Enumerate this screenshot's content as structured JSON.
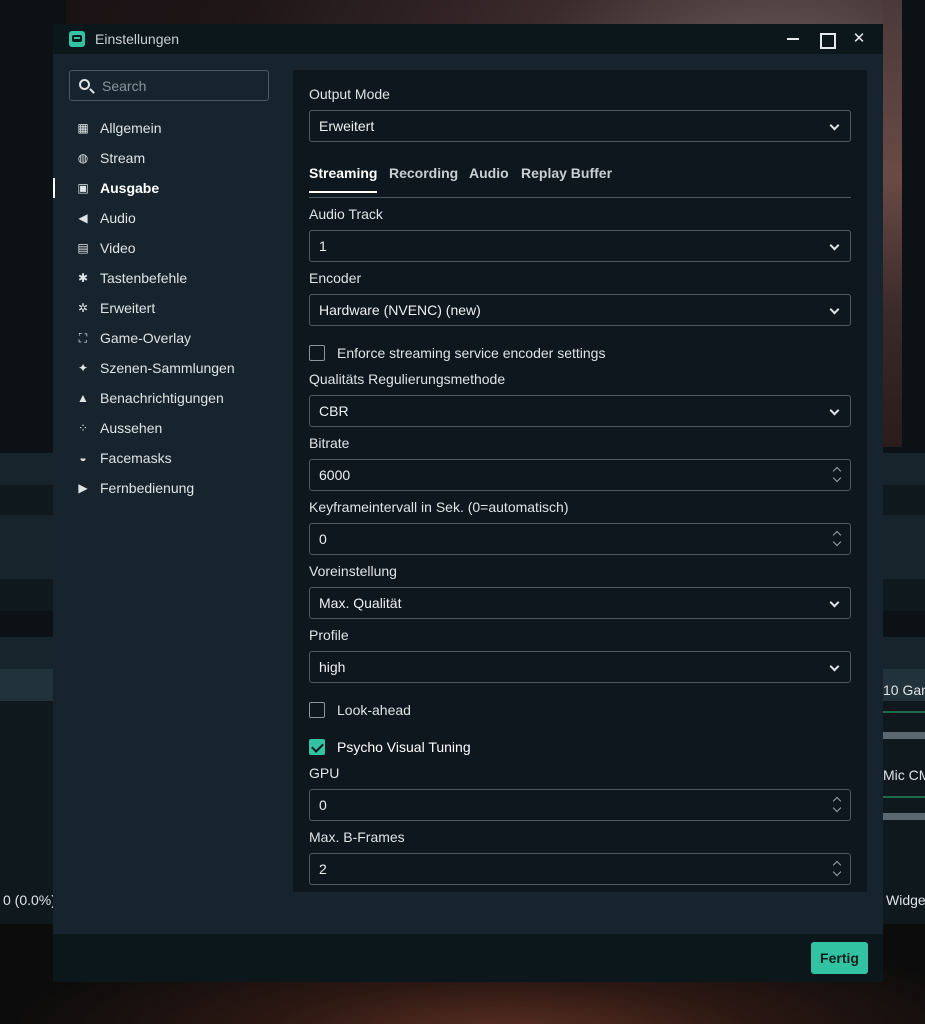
{
  "background": {
    "left_status": "0 (0.0%)",
    "right_labels": [
      "10 Gan",
      "Mic CM",
      "Widge"
    ]
  },
  "window": {
    "title": "Einstellungen"
  },
  "sidebar": {
    "search_placeholder": "Search",
    "items": [
      {
        "label": "Allgemein",
        "icon": "grid-icon"
      },
      {
        "label": "Stream",
        "icon": "globe-icon"
      },
      {
        "label": "Ausgabe",
        "icon": "chip-icon",
        "active": true
      },
      {
        "label": "Audio",
        "icon": "speaker-icon"
      },
      {
        "label": "Video",
        "icon": "film-icon"
      },
      {
        "label": "Tastenbefehle",
        "icon": "gear-icon"
      },
      {
        "label": "Erweitert",
        "icon": "gears-icon"
      },
      {
        "label": "Game-Overlay",
        "icon": "expand-icon"
      },
      {
        "label": "Szenen-Sammlungen",
        "icon": "wand-icon"
      },
      {
        "label": "Benachrichtigungen",
        "icon": "bell-icon"
      },
      {
        "label": "Aussehen",
        "icon": "apps-icon"
      },
      {
        "label": "Facemasks",
        "icon": "mask-icon"
      },
      {
        "label": "Fernbedienung",
        "icon": "play-circle-icon"
      }
    ]
  },
  "output": {
    "mode_label": "Output Mode",
    "mode_value": "Erweitert",
    "tabs": [
      {
        "label": "Streaming",
        "active": true
      },
      {
        "label": "Recording"
      },
      {
        "label": "Audio"
      },
      {
        "label": "Replay Buffer"
      }
    ],
    "audio_track": {
      "label": "Audio Track",
      "value": "1"
    },
    "encoder": {
      "label": "Encoder",
      "value": "Hardware (NVENC) (new)"
    },
    "enforce": {
      "label": "Enforce streaming service encoder settings",
      "checked": false
    },
    "rate_control": {
      "label": "Qualitäts Regulierungsmethode",
      "value": "CBR"
    },
    "bitrate": {
      "label": "Bitrate",
      "value": "6000"
    },
    "keyframe": {
      "label": "Keyframeintervall in Sek. (0=automatisch)",
      "value": "0"
    },
    "preset": {
      "label": "Voreinstellung",
      "value": "Max. Qualität"
    },
    "profile": {
      "label": "Profile",
      "value": "high"
    },
    "lookahead": {
      "label": "Look-ahead",
      "checked": false
    },
    "psycho": {
      "label": "Psycho Visual Tuning",
      "checked": true
    },
    "gpu": {
      "label": "GPU",
      "value": "0"
    },
    "bframes": {
      "label": "Max. B-Frames",
      "value": "2"
    }
  },
  "footer": {
    "done_label": "Fertig"
  },
  "colors": {
    "accent": "#31c3a2",
    "dialog_bg": "#17242d",
    "panel_bg": "#0d171d"
  }
}
